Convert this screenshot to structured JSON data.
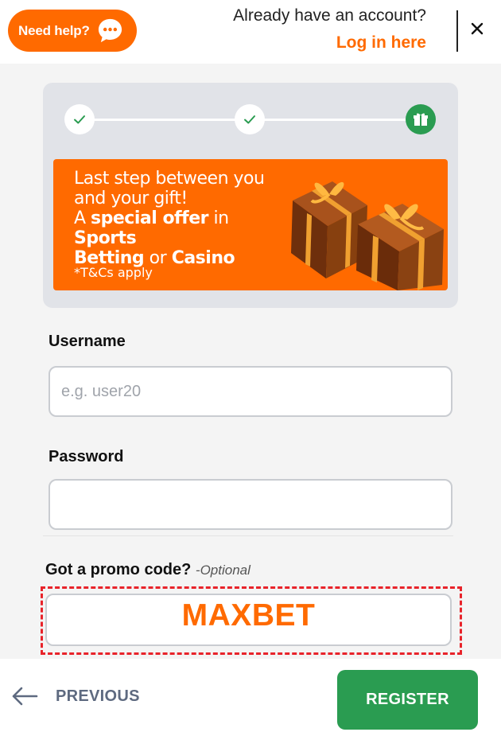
{
  "header": {
    "help_label": "Need help?",
    "account_question": "Already have an account?",
    "login_link": "Log in here",
    "help_icon": "chat-bubble-icon",
    "close_icon": "close-icon"
  },
  "progress": {
    "steps": [
      {
        "state": "done",
        "icon": "check-icon"
      },
      {
        "state": "done",
        "icon": "check-icon"
      },
      {
        "state": "current",
        "icon": "gift-icon"
      }
    ]
  },
  "banner": {
    "line1": "Last step between you",
    "line2": "and your gift!",
    "line3_a": "A ",
    "line3_b": "special offer",
    "line3_c": " in ",
    "line3_d": "Sports",
    "line4_a": "Betting",
    "line4_b": " or ",
    "line4_c": "Casino",
    "tcs": "*T&Cs apply"
  },
  "form": {
    "username_label": "Username",
    "username_placeholder": "e.g. user20",
    "password_label": "Password",
    "promo_label": "Got a promo code?",
    "promo_optional": "-Optional",
    "promo_value": "MAXBET"
  },
  "footer": {
    "previous_label": "PREVIOUS",
    "register_label": "REGISTER"
  },
  "colors": {
    "brand_orange": "#ff6a00",
    "success_green": "#2a9c51",
    "highlight_red": "#e8232a"
  }
}
